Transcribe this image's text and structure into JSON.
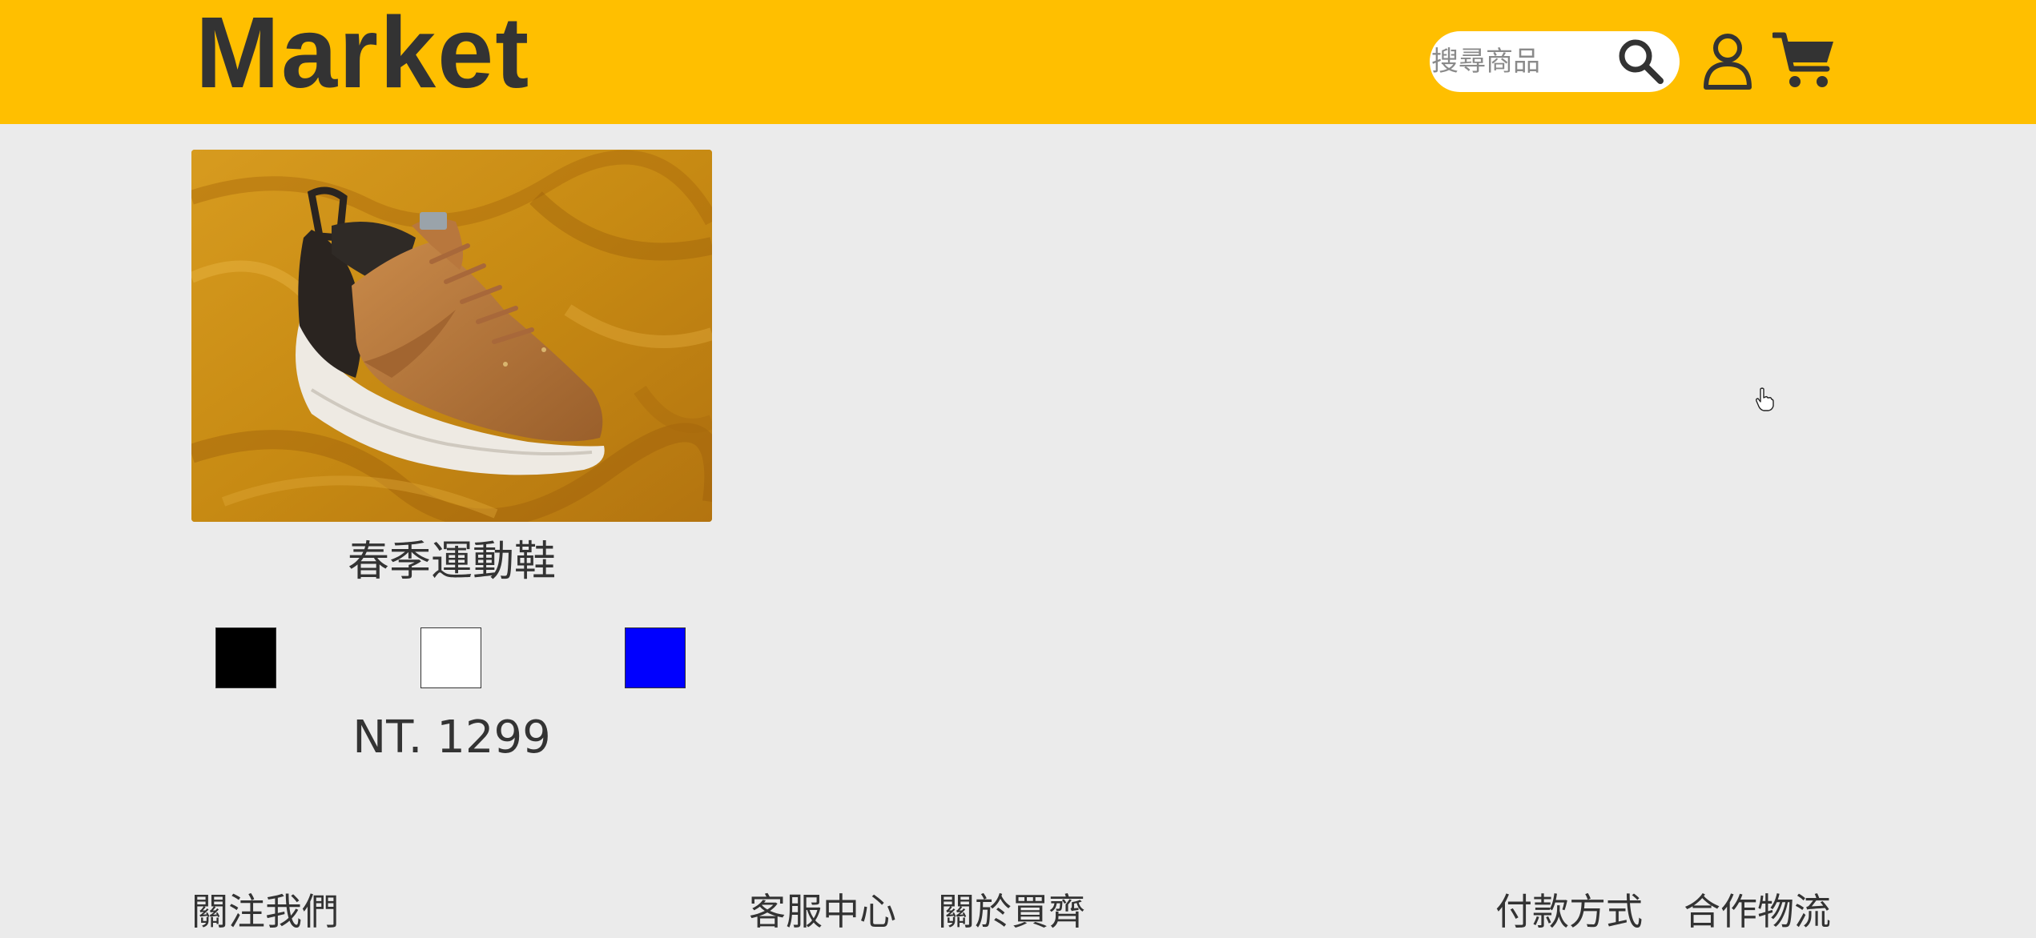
{
  "header": {
    "logo": "Market",
    "search_placeholder": "搜尋商品",
    "search_value": "",
    "icons": {
      "search": "search-icon",
      "member": "user-icon",
      "cart": "cart-icon"
    }
  },
  "colors": {
    "header_bg": "#ffbf00",
    "page_bg": "#ebebeb",
    "text": "#333333"
  },
  "product": {
    "name": "春季運動鞋",
    "price": "NT. 1299",
    "image": "sneaker-on-mustard-fabric",
    "colors": [
      {
        "name": "black",
        "hex": "#000000"
      },
      {
        "name": "white",
        "hex": "#ffffff"
      },
      {
        "name": "blue",
        "hex": "#0000ff"
      }
    ]
  },
  "footer": {
    "follow": "關注我們",
    "service": "客服中心",
    "about": "關於買齊",
    "payment": "付款方式",
    "shipping": "合作物流"
  }
}
